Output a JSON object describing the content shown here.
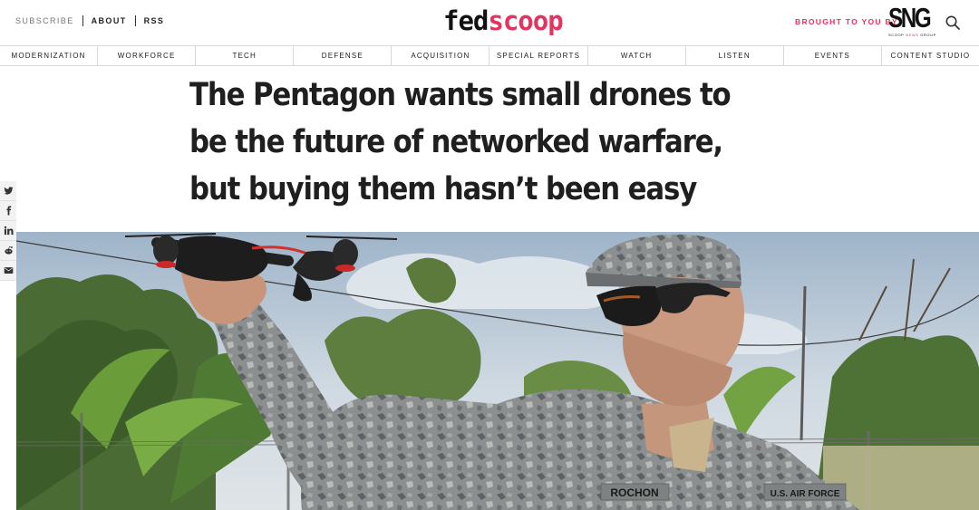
{
  "header": {
    "links": {
      "subscribe": "SUBSCRIBE",
      "about": "ABOUT",
      "rss": "RSS"
    },
    "logo": {
      "part1": "fed",
      "part2": "scoop"
    },
    "sponsor": {
      "label": "BROUGHT TO YOU BY",
      "name": "SNG",
      "sub_left": "SCOOP",
      "sub_mid": "NEWS",
      "sub_right": "GROUP"
    },
    "search_icon": "search-icon"
  },
  "nav": {
    "items": [
      "MODERNIZATION",
      "WORKFORCE",
      "TECH",
      "DEFENSE",
      "ACQUISITION",
      "SPECIAL REPORTS",
      "WATCH",
      "LISTEN",
      "EVENTS",
      "CONTENT STUDIO"
    ]
  },
  "article": {
    "title": "The Pentagon wants small drones to be the future of networked warfare, but buying them hasn’t been easy"
  },
  "share": {
    "icons": [
      "twitter-icon",
      "facebook-icon",
      "linkedin-icon",
      "reddit-icon",
      "email-icon"
    ]
  },
  "hero": {
    "name_tape": "ROCHON",
    "branch_tape": "U.S. AIR FORCE"
  },
  "colors": {
    "accent": "#e4335f",
    "text": "#1f1f1f",
    "border": "#d8d8d8"
  }
}
